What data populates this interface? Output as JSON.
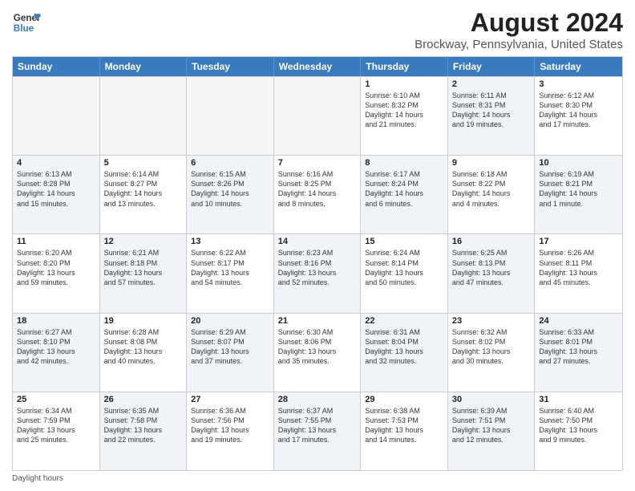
{
  "logo": {
    "line1": "General",
    "line2": "Blue"
  },
  "title": "August 2024",
  "subtitle": "Brockway, Pennsylvania, United States",
  "days": [
    "Sunday",
    "Monday",
    "Tuesday",
    "Wednesday",
    "Thursday",
    "Friday",
    "Saturday"
  ],
  "footer": "Daylight hours",
  "rows": [
    [
      {
        "day": "",
        "lines": [],
        "shaded": false,
        "empty": true
      },
      {
        "day": "",
        "lines": [],
        "shaded": false,
        "empty": true
      },
      {
        "day": "",
        "lines": [],
        "shaded": false,
        "empty": true
      },
      {
        "day": "",
        "lines": [],
        "shaded": false,
        "empty": true
      },
      {
        "day": "1",
        "lines": [
          "Sunrise: 6:10 AM",
          "Sunset: 8:32 PM",
          "Daylight: 14 hours",
          "and 21 minutes."
        ],
        "shaded": false
      },
      {
        "day": "2",
        "lines": [
          "Sunrise: 6:11 AM",
          "Sunset: 8:31 PM",
          "Daylight: 14 hours",
          "and 19 minutes."
        ],
        "shaded": true
      },
      {
        "day": "3",
        "lines": [
          "Sunrise: 6:12 AM",
          "Sunset: 8:30 PM",
          "Daylight: 14 hours",
          "and 17 minutes."
        ],
        "shaded": false
      }
    ],
    [
      {
        "day": "4",
        "lines": [
          "Sunrise: 6:13 AM",
          "Sunset: 8:28 PM",
          "Daylight: 14 hours",
          "and 15 minutes."
        ],
        "shaded": true
      },
      {
        "day": "5",
        "lines": [
          "Sunrise: 6:14 AM",
          "Sunset: 8:27 PM",
          "Daylight: 14 hours",
          "and 13 minutes."
        ],
        "shaded": false
      },
      {
        "day": "6",
        "lines": [
          "Sunrise: 6:15 AM",
          "Sunset: 8:26 PM",
          "Daylight: 14 hours",
          "and 10 minutes."
        ],
        "shaded": true
      },
      {
        "day": "7",
        "lines": [
          "Sunrise: 6:16 AM",
          "Sunset: 8:25 PM",
          "Daylight: 14 hours",
          "and 8 minutes."
        ],
        "shaded": false
      },
      {
        "day": "8",
        "lines": [
          "Sunrise: 6:17 AM",
          "Sunset: 8:24 PM",
          "Daylight: 14 hours",
          "and 6 minutes."
        ],
        "shaded": true
      },
      {
        "day": "9",
        "lines": [
          "Sunrise: 6:18 AM",
          "Sunset: 8:22 PM",
          "Daylight: 14 hours",
          "and 4 minutes."
        ],
        "shaded": false
      },
      {
        "day": "10",
        "lines": [
          "Sunrise: 6:19 AM",
          "Sunset: 8:21 PM",
          "Daylight: 14 hours",
          "and 1 minute."
        ],
        "shaded": true
      }
    ],
    [
      {
        "day": "11",
        "lines": [
          "Sunrise: 6:20 AM",
          "Sunset: 8:20 PM",
          "Daylight: 13 hours",
          "and 59 minutes."
        ],
        "shaded": false
      },
      {
        "day": "12",
        "lines": [
          "Sunrise: 6:21 AM",
          "Sunset: 8:18 PM",
          "Daylight: 13 hours",
          "and 57 minutes."
        ],
        "shaded": true
      },
      {
        "day": "13",
        "lines": [
          "Sunrise: 6:22 AM",
          "Sunset: 8:17 PM",
          "Daylight: 13 hours",
          "and 54 minutes."
        ],
        "shaded": false
      },
      {
        "day": "14",
        "lines": [
          "Sunrise: 6:23 AM",
          "Sunset: 8:16 PM",
          "Daylight: 13 hours",
          "and 52 minutes."
        ],
        "shaded": true
      },
      {
        "day": "15",
        "lines": [
          "Sunrise: 6:24 AM",
          "Sunset: 8:14 PM",
          "Daylight: 13 hours",
          "and 50 minutes."
        ],
        "shaded": false
      },
      {
        "day": "16",
        "lines": [
          "Sunrise: 6:25 AM",
          "Sunset: 8:13 PM",
          "Daylight: 13 hours",
          "and 47 minutes."
        ],
        "shaded": true
      },
      {
        "day": "17",
        "lines": [
          "Sunrise: 6:26 AM",
          "Sunset: 8:11 PM",
          "Daylight: 13 hours",
          "and 45 minutes."
        ],
        "shaded": false
      }
    ],
    [
      {
        "day": "18",
        "lines": [
          "Sunrise: 6:27 AM",
          "Sunset: 8:10 PM",
          "Daylight: 13 hours",
          "and 42 minutes."
        ],
        "shaded": true
      },
      {
        "day": "19",
        "lines": [
          "Sunrise: 6:28 AM",
          "Sunset: 8:08 PM",
          "Daylight: 13 hours",
          "and 40 minutes."
        ],
        "shaded": false
      },
      {
        "day": "20",
        "lines": [
          "Sunrise: 6:29 AM",
          "Sunset: 8:07 PM",
          "Daylight: 13 hours",
          "and 37 minutes."
        ],
        "shaded": true
      },
      {
        "day": "21",
        "lines": [
          "Sunrise: 6:30 AM",
          "Sunset: 8:06 PM",
          "Daylight: 13 hours",
          "and 35 minutes."
        ],
        "shaded": false
      },
      {
        "day": "22",
        "lines": [
          "Sunrise: 6:31 AM",
          "Sunset: 8:04 PM",
          "Daylight: 13 hours",
          "and 32 minutes."
        ],
        "shaded": true
      },
      {
        "day": "23",
        "lines": [
          "Sunrise: 6:32 AM",
          "Sunset: 8:02 PM",
          "Daylight: 13 hours",
          "and 30 minutes."
        ],
        "shaded": false
      },
      {
        "day": "24",
        "lines": [
          "Sunrise: 6:33 AM",
          "Sunset: 8:01 PM",
          "Daylight: 13 hours",
          "and 27 minutes."
        ],
        "shaded": true
      }
    ],
    [
      {
        "day": "25",
        "lines": [
          "Sunrise: 6:34 AM",
          "Sunset: 7:59 PM",
          "Daylight: 13 hours",
          "and 25 minutes."
        ],
        "shaded": false
      },
      {
        "day": "26",
        "lines": [
          "Sunrise: 6:35 AM",
          "Sunset: 7:58 PM",
          "Daylight: 13 hours",
          "and 22 minutes."
        ],
        "shaded": true
      },
      {
        "day": "27",
        "lines": [
          "Sunrise: 6:36 AM",
          "Sunset: 7:56 PM",
          "Daylight: 13 hours",
          "and 19 minutes."
        ],
        "shaded": false
      },
      {
        "day": "28",
        "lines": [
          "Sunrise: 6:37 AM",
          "Sunset: 7:55 PM",
          "Daylight: 13 hours",
          "and 17 minutes."
        ],
        "shaded": true
      },
      {
        "day": "29",
        "lines": [
          "Sunrise: 6:38 AM",
          "Sunset: 7:53 PM",
          "Daylight: 13 hours",
          "and 14 minutes."
        ],
        "shaded": false
      },
      {
        "day": "30",
        "lines": [
          "Sunrise: 6:39 AM",
          "Sunset: 7:51 PM",
          "Daylight: 13 hours",
          "and 12 minutes."
        ],
        "shaded": true
      },
      {
        "day": "31",
        "lines": [
          "Sunrise: 6:40 AM",
          "Sunset: 7:50 PM",
          "Daylight: 13 hours",
          "and 9 minutes."
        ],
        "shaded": false
      }
    ]
  ]
}
